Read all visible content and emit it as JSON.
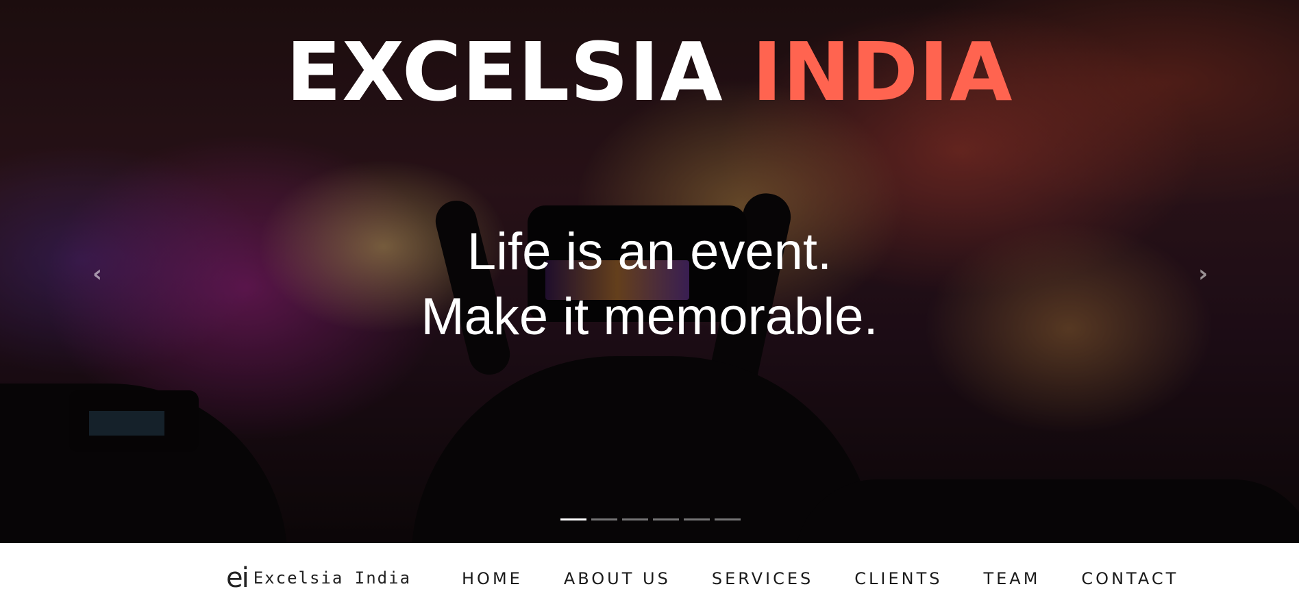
{
  "hero": {
    "title_main": "EXCELSIA",
    "title_accent": "INDIA",
    "tagline_line1": "Life is an event.",
    "tagline_line2": "Make it memorable.",
    "prev_arrow": "‹",
    "next_arrow": "›",
    "slide_count": 6,
    "active_slide": 1,
    "accent_color": "#ff6450"
  },
  "navbar": {
    "logo_mark": "ei",
    "logo_text": "Excelsia India",
    "links": [
      {
        "label": "HOME"
      },
      {
        "label": "ABOUT US"
      },
      {
        "label": "SERVICES"
      },
      {
        "label": "CLIENTS"
      },
      {
        "label": "TEAM"
      },
      {
        "label": "CONTACT"
      }
    ]
  }
}
